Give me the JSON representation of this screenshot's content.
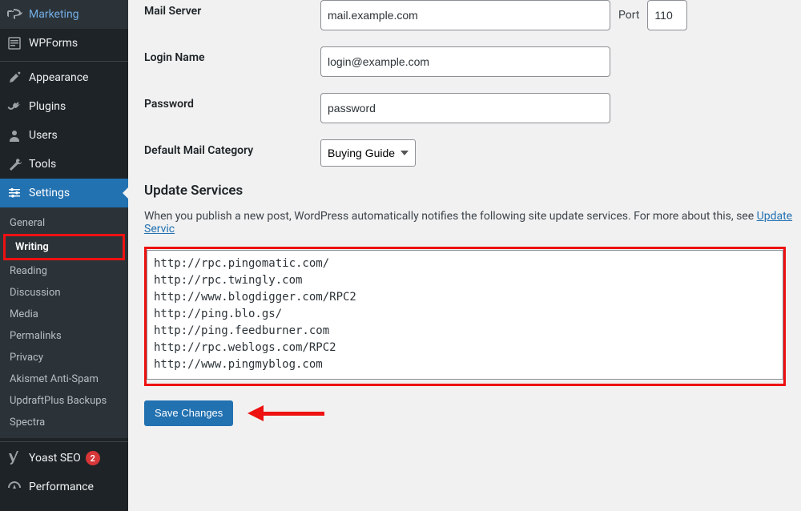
{
  "sidebar": {
    "marketing": "Marketing",
    "wpforms": "WPForms",
    "appearance": "Appearance",
    "plugins": "Plugins",
    "users": "Users",
    "tools": "Tools",
    "settings": "Settings",
    "yoast": "Yoast SEO",
    "yoast_badge": "2",
    "performance": "Performance"
  },
  "settings_submenu": {
    "general": "General",
    "writing": "Writing",
    "reading": "Reading",
    "discussion": "Discussion",
    "media": "Media",
    "permalinks": "Permalinks",
    "privacy": "Privacy",
    "akismet": "Akismet Anti-Spam",
    "updraft": "UpdraftPlus Backups",
    "spectra": "Spectra"
  },
  "form": {
    "mail_server_label": "Mail Server",
    "mail_server_value": "mail.example.com",
    "port_label": "Port",
    "port_value": "110",
    "login_label": "Login Name",
    "login_value": "login@example.com",
    "password_label": "Password",
    "password_value": "password",
    "default_cat_label": "Default Mail Category",
    "default_cat_value": "Buying Guide"
  },
  "update_services": {
    "heading": "Update Services",
    "description_prefix": "When you publish a new post, WordPress automatically notifies the following site update services. For more about this, see ",
    "description_link": "Update Servic",
    "textarea": "http://rpc.pingomatic.com/\nhttp://rpc.twingly.com\nhttp://www.blogdigger.com/RPC2\nhttp://ping.blo.gs/\nhttp://ping.feedburner.com\nhttp://rpc.weblogs.com/RPC2\nhttp://www.pingmyblog.com"
  },
  "buttons": {
    "save": "Save Changes"
  }
}
